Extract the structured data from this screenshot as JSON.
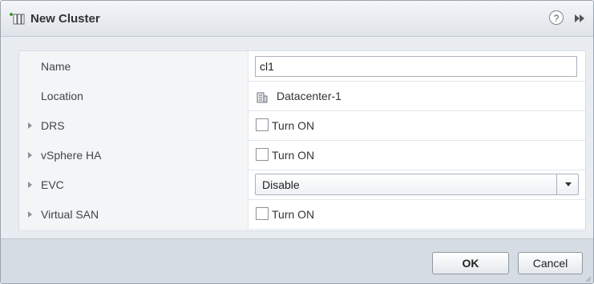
{
  "dialog": {
    "title": "New Cluster",
    "title_icon": "new-cluster-icon",
    "help_glyph": "?"
  },
  "rows": [
    {
      "label": "Name",
      "type": "text",
      "value": "cl1"
    },
    {
      "label": "Location",
      "type": "static",
      "value": "Datacenter-1",
      "icon": "datacenter-icon"
    },
    {
      "label": "DRS",
      "type": "checkbox",
      "checkbox_label": "Turn ON",
      "checked": false,
      "expandable": true
    },
    {
      "label": "vSphere HA",
      "type": "checkbox",
      "checkbox_label": "Turn ON",
      "checked": false,
      "expandable": true
    },
    {
      "label": "EVC",
      "type": "select",
      "value": "Disable",
      "expandable": true
    },
    {
      "label": "Virtual SAN",
      "type": "checkbox",
      "checkbox_label": "Turn ON",
      "checked": false,
      "expandable": true
    }
  ],
  "footer": {
    "ok_label": "OK",
    "cancel_label": "Cancel"
  }
}
